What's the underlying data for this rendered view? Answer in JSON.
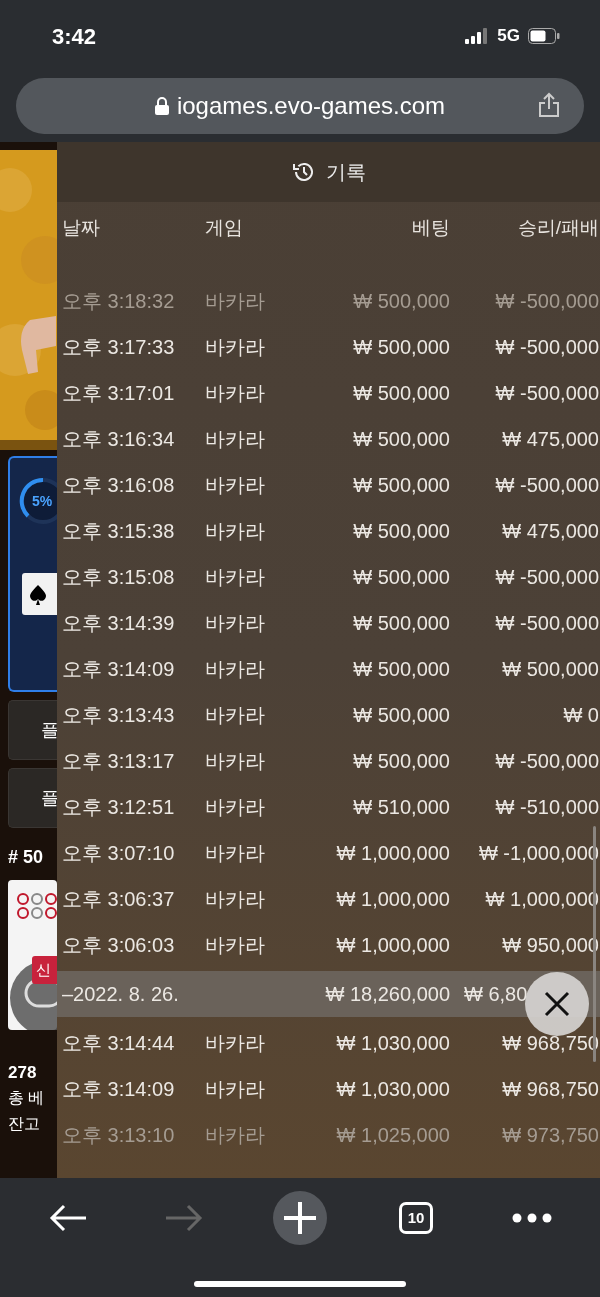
{
  "status_bar": {
    "time": "3:42",
    "network": "5G"
  },
  "address_bar": {
    "url": "iogames.evo-games.com"
  },
  "background_game": {
    "progress": "5%",
    "buttons": [
      {
        "label": "플"
      },
      {
        "label": "플"
      }
    ],
    "table_number": "# 50",
    "badge": "신",
    "players": "278",
    "total_bet_label": "총 베",
    "balance_label": "잔고"
  },
  "history": {
    "title": "기록",
    "columns": [
      "날짜",
      "게임",
      "베팅",
      "승리/패배"
    ],
    "rows": [
      {
        "kind": "row",
        "dimmed": true,
        "date": "오후 3:18:32",
        "game": "바카라",
        "bet": "₩ 500,000",
        "result": "₩ -500,000"
      },
      {
        "kind": "row",
        "dimmed": false,
        "date": "오후 3:17:33",
        "game": "바카라",
        "bet": "₩ 500,000",
        "result": "₩ -500,000"
      },
      {
        "kind": "row",
        "dimmed": false,
        "date": "오후 3:17:01",
        "game": "바카라",
        "bet": "₩ 500,000",
        "result": "₩ -500,000"
      },
      {
        "kind": "row",
        "dimmed": false,
        "date": "오후 3:16:34",
        "game": "바카라",
        "bet": "₩ 500,000",
        "result": "₩ 475,000"
      },
      {
        "kind": "row",
        "dimmed": false,
        "date": "오후 3:16:08",
        "game": "바카라",
        "bet": "₩ 500,000",
        "result": "₩ -500,000"
      },
      {
        "kind": "row",
        "dimmed": false,
        "date": "오후 3:15:38",
        "game": "바카라",
        "bet": "₩ 500,000",
        "result": "₩ 475,000"
      },
      {
        "kind": "row",
        "dimmed": false,
        "date": "오후 3:15:08",
        "game": "바카라",
        "bet": "₩ 500,000",
        "result": "₩ -500,000"
      },
      {
        "kind": "row",
        "dimmed": false,
        "date": "오후 3:14:39",
        "game": "바카라",
        "bet": "₩ 500,000",
        "result": "₩ -500,000"
      },
      {
        "kind": "row",
        "dimmed": false,
        "date": "오후 3:14:09",
        "game": "바카라",
        "bet": "₩ 500,000",
        "result": "₩ 500,000"
      },
      {
        "kind": "row",
        "dimmed": false,
        "date": "오후 3:13:43",
        "game": "바카라",
        "bet": "₩ 500,000",
        "result": "₩ 0"
      },
      {
        "kind": "row",
        "dimmed": false,
        "date": "오후 3:13:17",
        "game": "바카라",
        "bet": "₩ 500,000",
        "result": "₩ -500,000"
      },
      {
        "kind": "row",
        "dimmed": false,
        "date": "오후 3:12:51",
        "game": "바카라",
        "bet": "₩ 510,000",
        "result": "₩ -510,000"
      },
      {
        "kind": "row",
        "dimmed": false,
        "date": "오후 3:07:10",
        "game": "바카라",
        "bet": "₩ 1,000,000",
        "result": "₩ -1,000,000"
      },
      {
        "kind": "row",
        "dimmed": false,
        "date": "오후 3:06:37",
        "game": "바카라",
        "bet": "₩ 1,000,000",
        "result": "₩ 1,000,000"
      },
      {
        "kind": "row",
        "dimmed": false,
        "date": "오후 3:06:03",
        "game": "바카라",
        "bet": "₩ 1,000,000",
        "result": "₩ 950,000"
      },
      {
        "kind": "summary",
        "dimmed": false,
        "date": "–2022. 8. 26.",
        "bet": "₩ 18,260,000",
        "result": "₩ 6,80"
      },
      {
        "kind": "row",
        "dimmed": false,
        "date": "오후 3:14:44",
        "game": "바카라",
        "bet": "₩ 1,030,000",
        "result": "₩ 968,750"
      },
      {
        "kind": "row",
        "dimmed": false,
        "date": "오후 3:14:09",
        "game": "바카라",
        "bet": "₩ 1,030,000",
        "result": "₩ 968,750"
      },
      {
        "kind": "row",
        "dimmed": true,
        "date": "오후 3:13:10",
        "game": "바카라",
        "bet": "₩ 1,025,000",
        "result": "₩ 973,750"
      }
    ]
  },
  "toolbar": {
    "back_enabled": true,
    "forward_enabled": false,
    "tab_count": "10"
  }
}
